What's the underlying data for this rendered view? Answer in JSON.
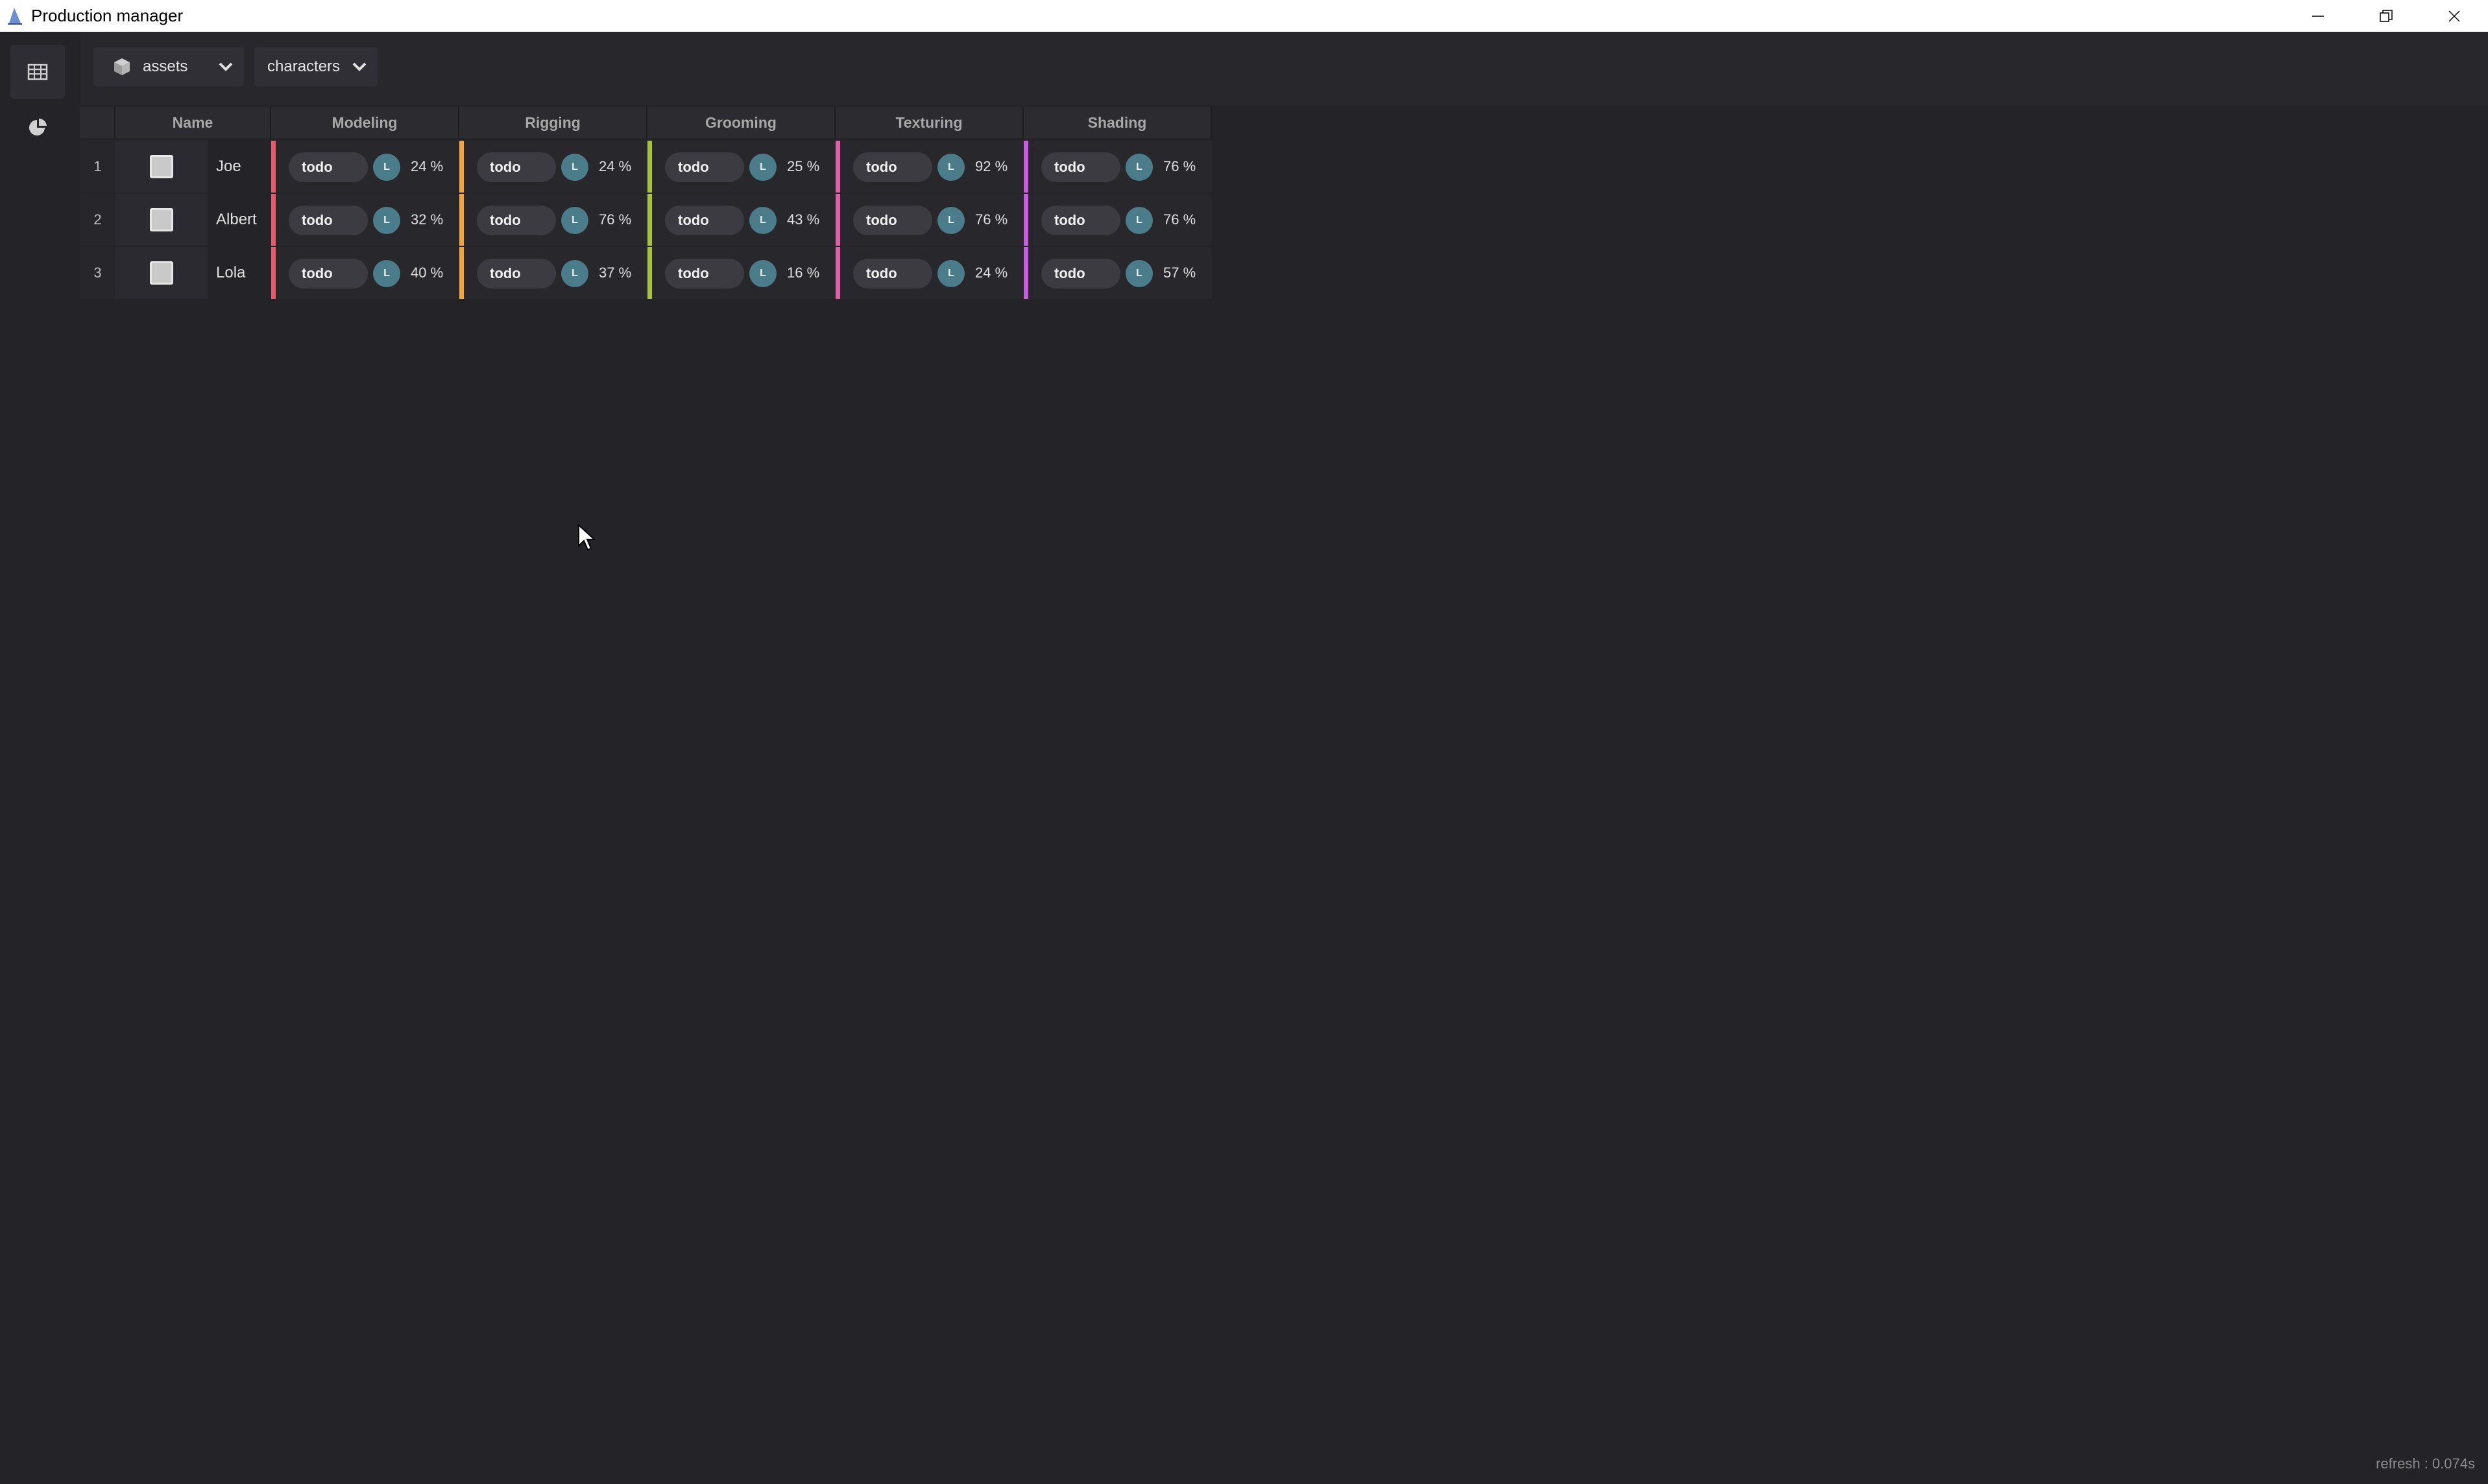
{
  "window": {
    "title": "Production manager"
  },
  "toolbar": {
    "category": {
      "label": "assets",
      "icon": "cube-icon"
    },
    "type": {
      "label": "characters"
    }
  },
  "table": {
    "headers": [
      "Name",
      "Modeling",
      "Rigging",
      "Grooming",
      "Texturing",
      "Shading"
    ],
    "task_colors": [
      "#e85a6a",
      "#f2a53c",
      "#a8c23a",
      "#e05fa8",
      "#c65fe0"
    ],
    "rows": [
      {
        "num": "1",
        "name": "Joe",
        "tasks": [
          {
            "status": "todo",
            "assignee": "L",
            "progress": "24 %"
          },
          {
            "status": "todo",
            "assignee": "L",
            "progress": "24 %"
          },
          {
            "status": "todo",
            "assignee": "L",
            "progress": "25 %"
          },
          {
            "status": "todo",
            "assignee": "L",
            "progress": "92 %"
          },
          {
            "status": "todo",
            "assignee": "L",
            "progress": "76 %"
          }
        ]
      },
      {
        "num": "2",
        "name": "Albert",
        "tasks": [
          {
            "status": "todo",
            "assignee": "L",
            "progress": "32 %"
          },
          {
            "status": "todo",
            "assignee": "L",
            "progress": "76 %"
          },
          {
            "status": "todo",
            "assignee": "L",
            "progress": "43 %"
          },
          {
            "status": "todo",
            "assignee": "L",
            "progress": "76 %"
          },
          {
            "status": "todo",
            "assignee": "L",
            "progress": "76 %"
          }
        ]
      },
      {
        "num": "3",
        "name": "Lola",
        "tasks": [
          {
            "status": "todo",
            "assignee": "L",
            "progress": "40 %"
          },
          {
            "status": "todo",
            "assignee": "L",
            "progress": "37 %"
          },
          {
            "status": "todo",
            "assignee": "L",
            "progress": "16 %"
          },
          {
            "status": "todo",
            "assignee": "L",
            "progress": "24 %"
          },
          {
            "status": "todo",
            "assignee": "L",
            "progress": "57 %"
          }
        ]
      }
    ]
  },
  "footer": {
    "refresh": "refresh : 0.074s"
  }
}
